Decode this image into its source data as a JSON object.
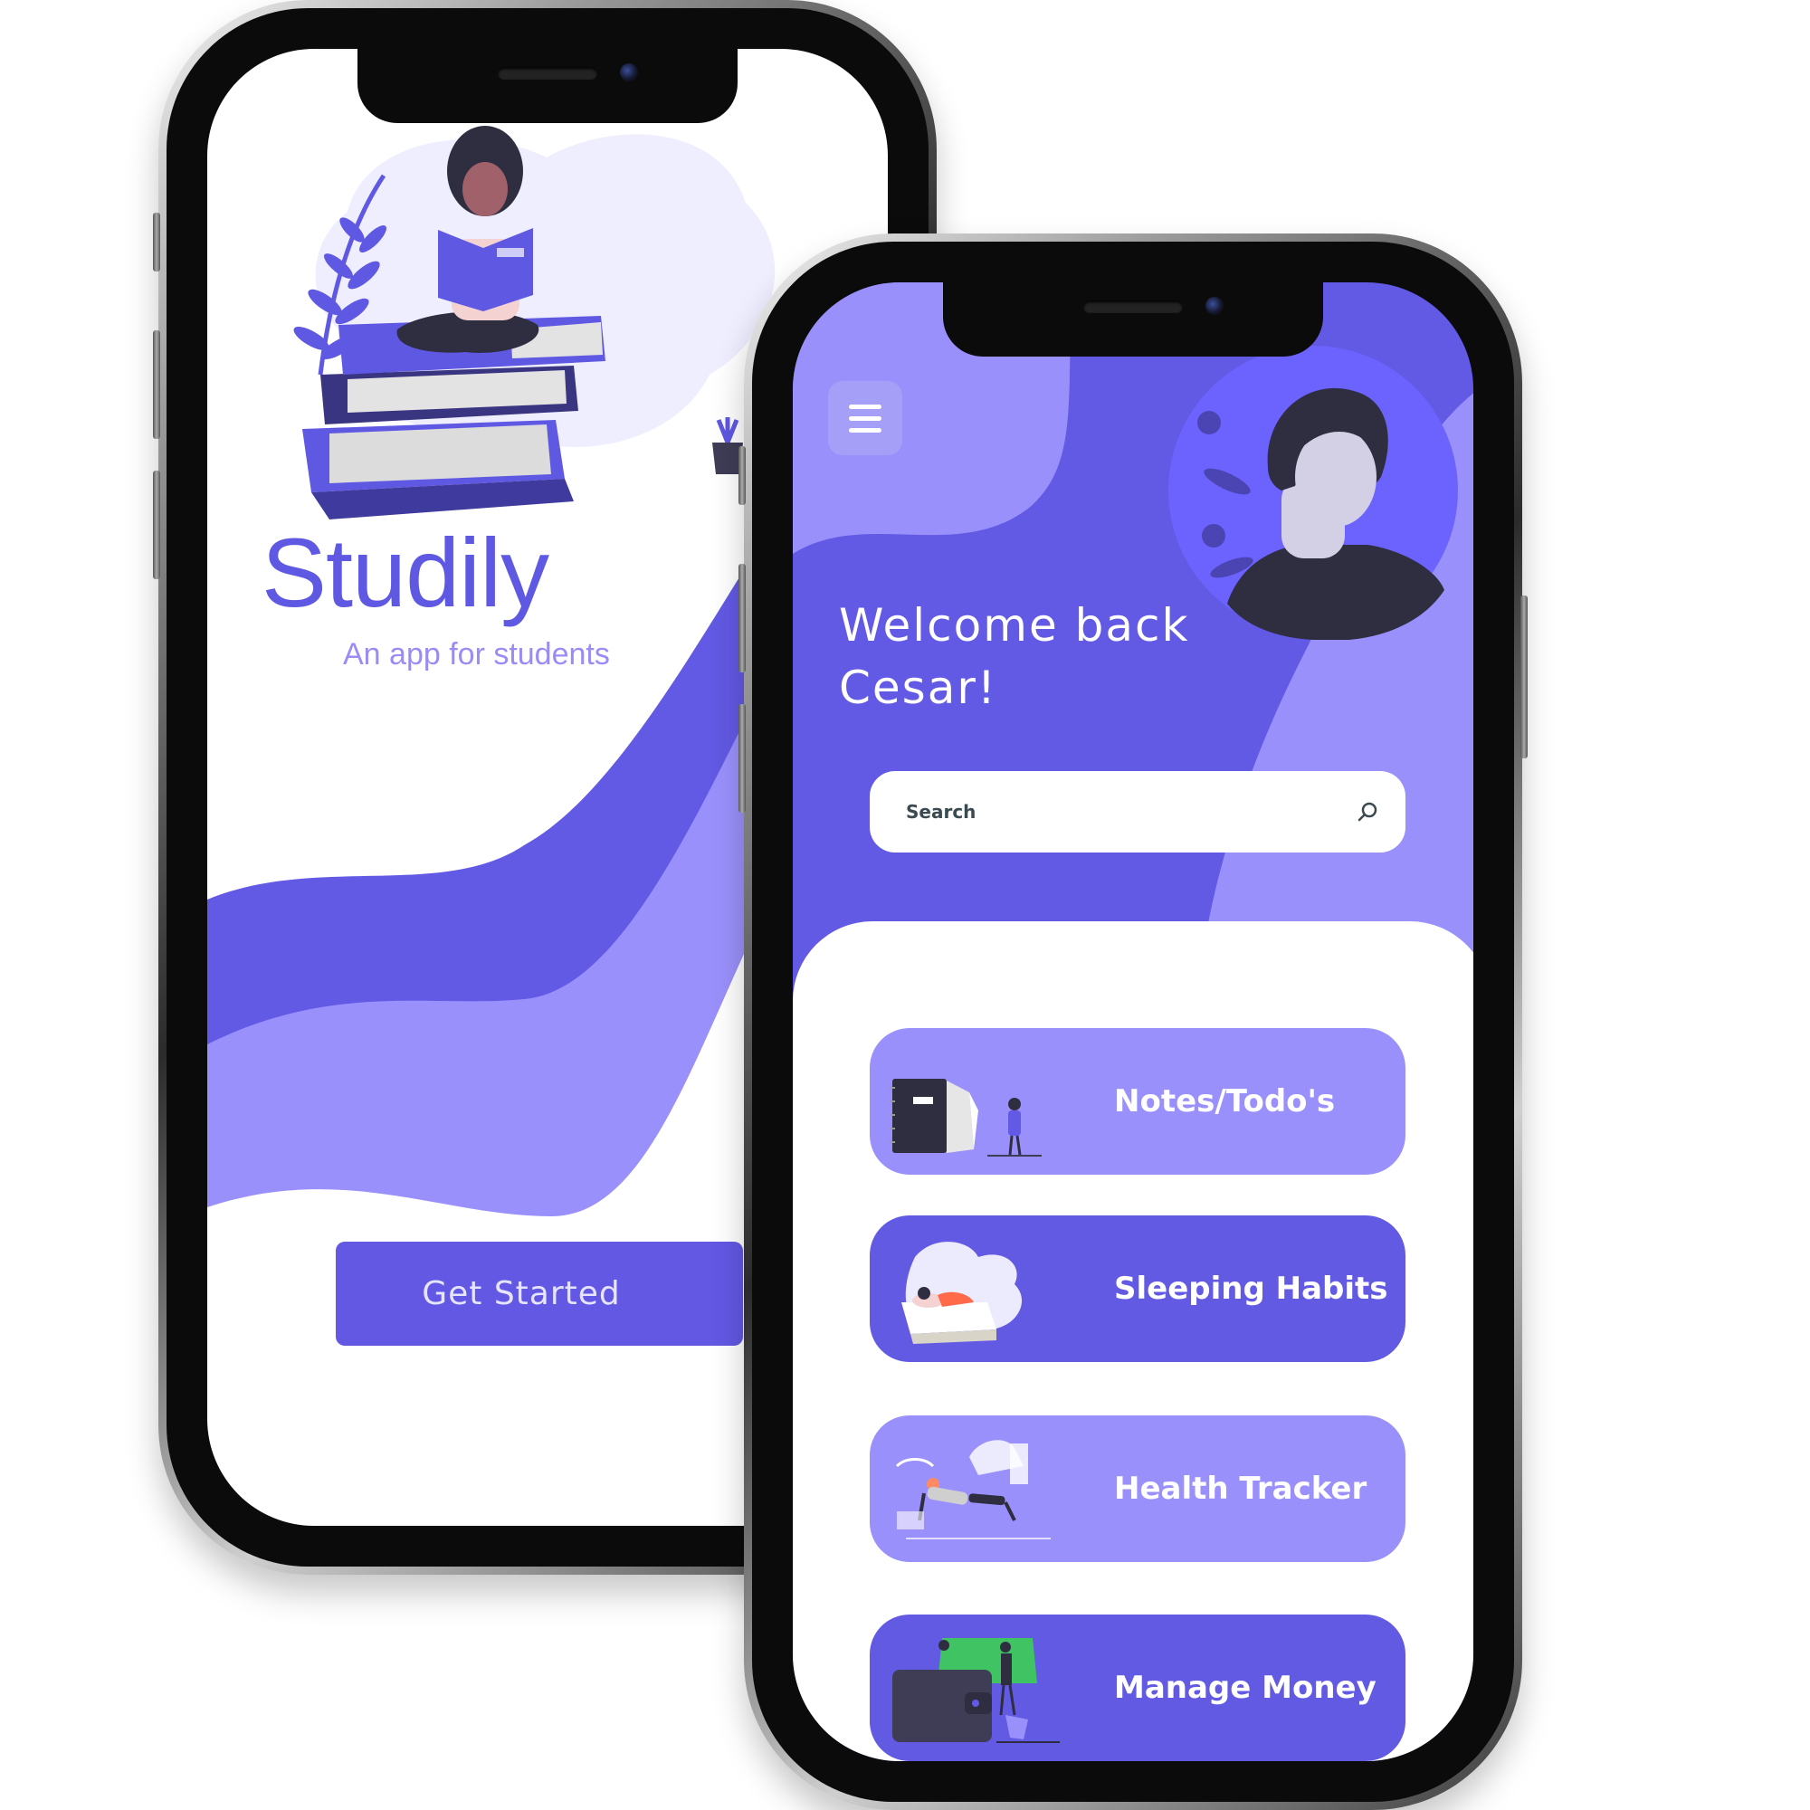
{
  "splash": {
    "title": "Studily",
    "subtitle": "An app for students",
    "cta_label": "Get Started"
  },
  "home": {
    "welcome_line1": "Welcome back",
    "welcome_line2": "Cesar!",
    "search_placeholder": "Search",
    "cards": [
      {
        "label": "Notes/Todo's",
        "icon": "notebook-illustration"
      },
      {
        "label": "Sleeping Habits",
        "icon": "sleeping-illustration"
      },
      {
        "label": "Health Tracker",
        "icon": "exercise-illustration"
      },
      {
        "label": "Manage Money",
        "icon": "wallet-illustration"
      }
    ]
  },
  "colors": {
    "primary": "#6259E4",
    "light_purple": "#9A90FB",
    "lavender_bg": "#EFEEFE",
    "white": "#FFFFFF",
    "dark_navy": "#2F2E41"
  },
  "icons": [
    "menu-icon",
    "search-icon",
    "avatar-illustration",
    "reading-girl-illustration"
  ]
}
